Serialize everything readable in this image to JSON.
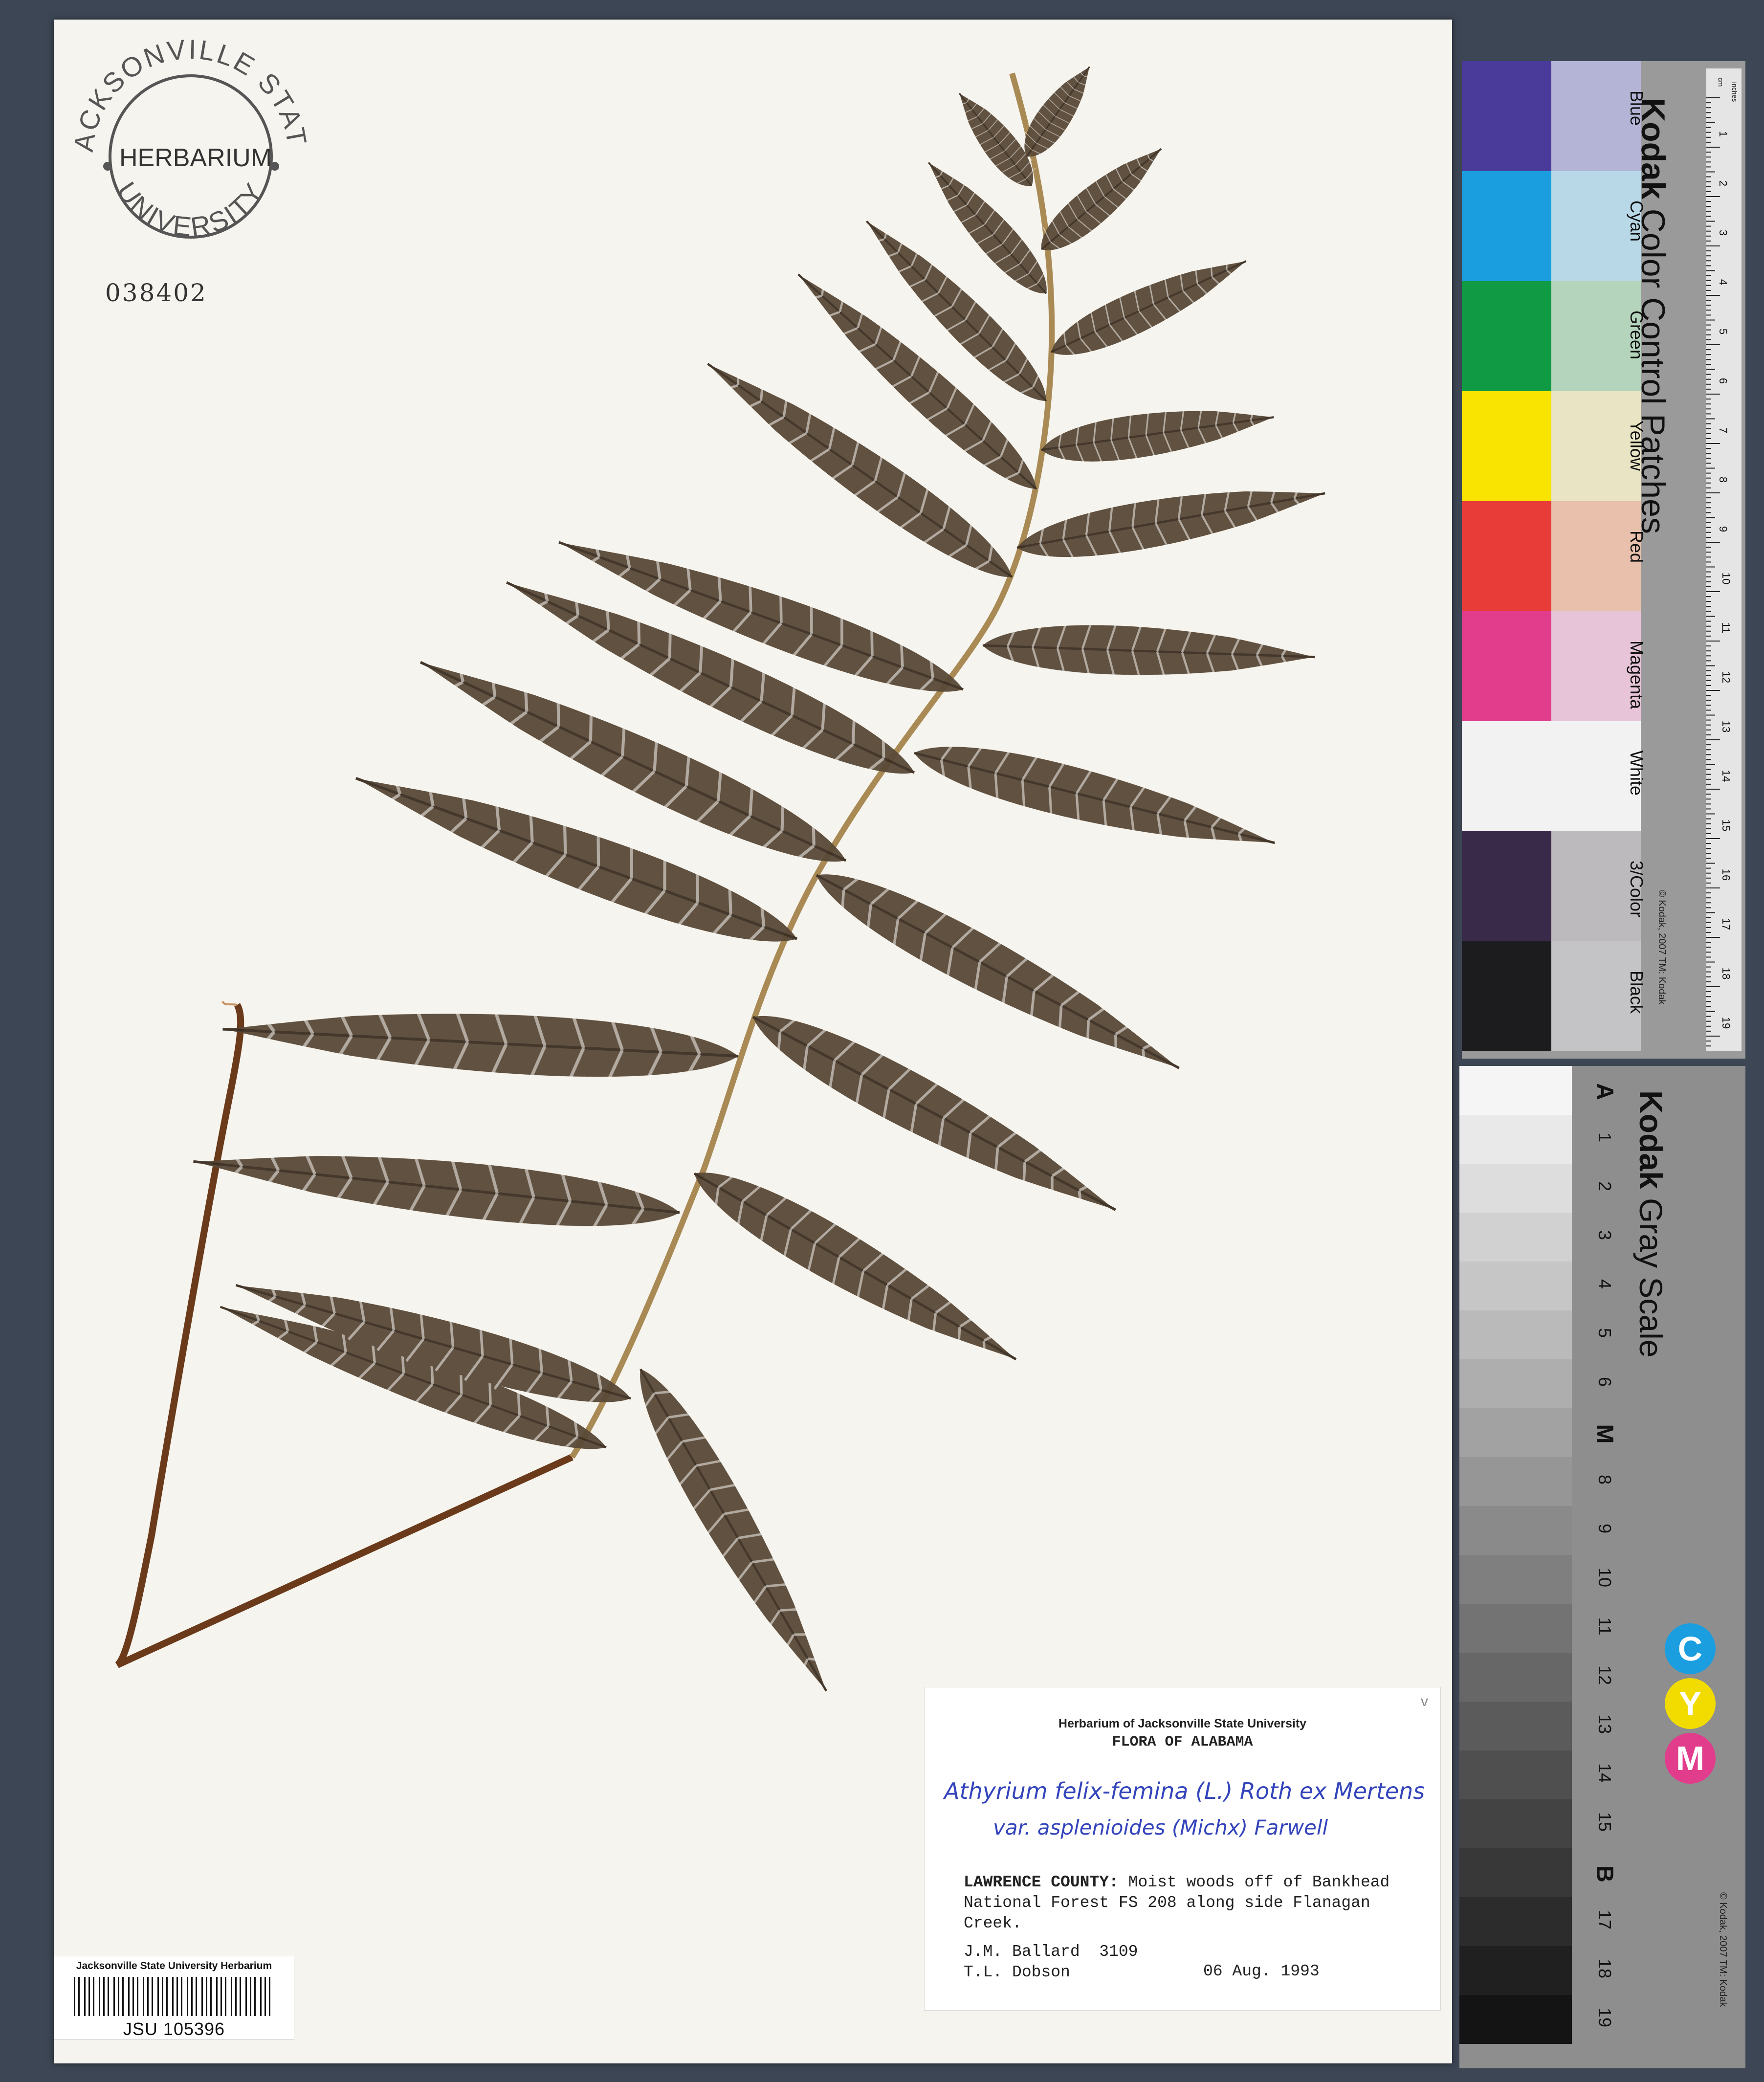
{
  "stamp": {
    "top_text": "JACKSONVILLE STATE",
    "center_text": "HERBARIUM",
    "bottom_text": "UNIVERSITY"
  },
  "accession_number": "038402",
  "barcode_label": {
    "institution": "Jacksonville State University Herbarium",
    "number": "JSU 105396"
  },
  "label": {
    "check_mark": "v",
    "herbarium": "Herbarium of Jacksonville State University",
    "flora": "FLORA OF ALABAMA",
    "name_line1": "Athyrium felix-femina (L.) Roth ex Mertens",
    "name_line2": "var. asplenioides (Michx) Farwell",
    "county": "LAWRENCE COUNTY:",
    "locality": "Moist woods off of Bankhead National Forest FS 208 along side Flanagan Creek.",
    "collectors": "J.M. Ballard  3109\nT.L. Dobson",
    "date": "06 Aug. 1993"
  },
  "color_card": {
    "brand_bold": "Kodak",
    "brand_rest": " Color Control Patches",
    "copyright": "© Kodak, 2007 TM: Kodak",
    "ruler_unit_cm": "cm",
    "ruler_unit_inches": "inches",
    "ruler_ticks": [
      "1",
      "2",
      "3",
      "4",
      "5",
      "6",
      "7",
      "8",
      "9",
      "10",
      "11",
      "12",
      "13",
      "14",
      "15",
      "16",
      "17",
      "18",
      "19"
    ],
    "patches": [
      {
        "name": "Blue",
        "dark": "#4a3a9a",
        "light": "#b4b4d6"
      },
      {
        "name": "Cyan",
        "dark": "#1a9ee0",
        "light": "#b8d8e8"
      },
      {
        "name": "Green",
        "dark": "#119a44",
        "light": "#b4d4bc"
      },
      {
        "name": "Yellow",
        "dark": "#f8e400",
        "light": "#e8e4c4"
      },
      {
        "name": "Red",
        "dark": "#e83c38",
        "light": "#e8c0ac"
      },
      {
        "name": "Magenta",
        "dark": "#e23c8c",
        "light": "#e8c4d8"
      },
      {
        "name": "White",
        "dark": "#f2f2f2",
        "light": "#f2f2f2"
      },
      {
        "name": "3/Color",
        "dark": "#3a2a4a",
        "light": "#bcbabc"
      },
      {
        "name": "Black",
        "dark": "#1c1c1e",
        "light": "#c4c4c6"
      }
    ]
  },
  "gray_card": {
    "brand_bold": "Kodak",
    "brand_rest": " Gray Scale",
    "copyright": "© Kodak, 2007 TM: Kodak",
    "steps": [
      "A",
      "1",
      "2",
      "3",
      "4",
      "5",
      "6",
      "M",
      "8",
      "9",
      "10",
      "11",
      "12",
      "13",
      "14",
      "15",
      "B",
      "17",
      "18",
      "19"
    ],
    "cmy": [
      {
        "letter": "C",
        "color": "#1a9ee0"
      },
      {
        "letter": "Y",
        "color": "#f2dc00"
      },
      {
        "letter": "M",
        "color": "#e23c8c"
      }
    ]
  }
}
